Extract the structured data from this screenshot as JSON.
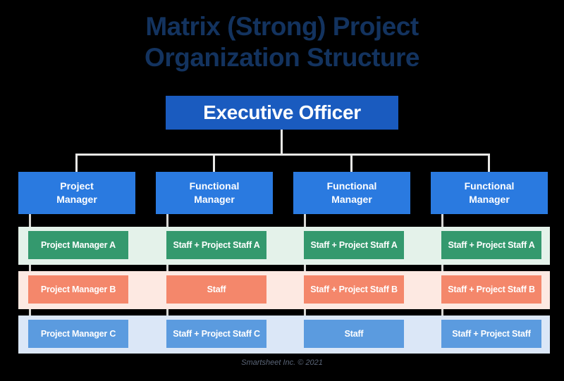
{
  "title": {
    "line1": "Matrix (Strong) Project",
    "line2": "Organization Structure"
  },
  "executive": {
    "label": "Executive Officer"
  },
  "managers": [
    {
      "line1": "Project",
      "line2": "Manager"
    },
    {
      "line1": "Functional",
      "line2": "Manager"
    },
    {
      "line1": "Functional",
      "line2": "Manager"
    },
    {
      "line1": "Functional",
      "line2": "Manager"
    }
  ],
  "rows": [
    {
      "name": "row-a",
      "cells": [
        "Project Manager A",
        "Staff + Project Staff A",
        "Staff + Project Staff A",
        "Staff + Project Staff A"
      ]
    },
    {
      "name": "row-b",
      "cells": [
        "Project Manager B",
        "Staff",
        "Staff + Project Staff B",
        "Staff + Project Staff B"
      ]
    },
    {
      "name": "row-c",
      "cells": [
        "Project Manager C",
        "Staff + Project Staff C",
        "Staff",
        "Staff + Project Staff"
      ]
    }
  ],
  "footer": {
    "credit": "Smartsheet Inc. © 2021"
  },
  "colors": {
    "title": "#13335f",
    "executive_box": "#1a5bbf",
    "manager_box": "#2a7ae0",
    "row_a_box": "#34996e",
    "row_a_band": "#e4f2ea",
    "row_b_box": "#f4876b",
    "row_b_band": "#fde9e2",
    "row_c_box": "#5b9bdf",
    "row_c_band": "#dbe7f7",
    "connector": "#e9e9e6",
    "background": "#000000",
    "footer_text": "#5a6577"
  }
}
